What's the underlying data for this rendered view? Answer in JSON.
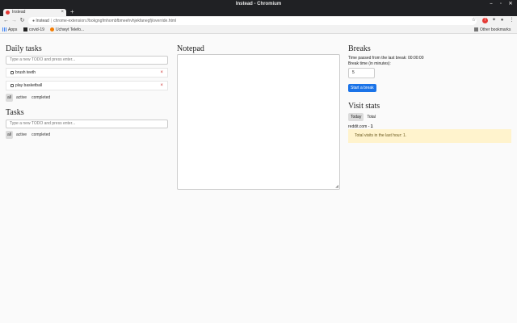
{
  "window": {
    "title": "Instead - Chromium"
  },
  "tab": {
    "label": "Instead"
  },
  "omnibox": {
    "site": "Instead",
    "url": "chrome-extension://bokgngfmhombfbmeehvhjekfanegfj/override.html"
  },
  "bookmarks": {
    "items": [
      {
        "label": "Apps"
      },
      {
        "label": "covid-19"
      },
      {
        "label": "Uchwyt Telefo..."
      }
    ],
    "other": "Other bookmarks"
  },
  "daily": {
    "title": "Daily tasks",
    "placeholder": "Type a new TODO and press enter...",
    "items": [
      {
        "label": "brush teeth"
      },
      {
        "label": "play basketball"
      }
    ],
    "filters": [
      "all",
      "active",
      "completed"
    ]
  },
  "tasks": {
    "title": "Tasks",
    "placeholder": "Type a new TODO and press enter...",
    "filters": [
      "all",
      "active",
      "completed"
    ]
  },
  "notepad": {
    "title": "Notepad"
  },
  "breaks": {
    "title": "Breaks",
    "time_label": "Time passed from the last break: 00:00:00",
    "break_time_label": "Break time (in minutes):",
    "break_time_value": "5",
    "start_label": "Start a break"
  },
  "stats": {
    "title": "Visit stats",
    "tabs": [
      "Today",
      "Total"
    ],
    "site": "reddit.com",
    "site_count": "1",
    "notice": "Total visits in the last hour: 1."
  },
  "colors": {
    "accent": "#1a73e8",
    "notice_bg": "#fff3cd",
    "delete": "#cc3333"
  }
}
